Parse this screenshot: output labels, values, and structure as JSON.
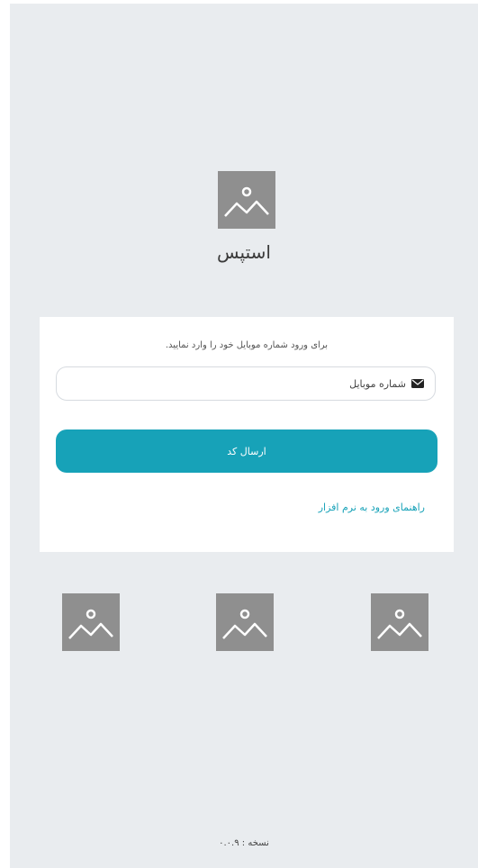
{
  "app": {
    "name": "استپس"
  },
  "login": {
    "prompt": "برای ورود شماره موبایل خود را وارد نمایید.",
    "phone_placeholder": "شماره موبایل",
    "phone_icon": "envelope-icon",
    "send_button": "ارسال کد",
    "help_link": "راهنمای ورود به نرم افزار"
  },
  "footer": {
    "version": "نسخه : ۰.۰.۹"
  },
  "images": {
    "logo_icon": "image-placeholder-icon",
    "bottom_icons": [
      "image-placeholder-icon",
      "image-placeholder-icon",
      "image-placeholder-icon"
    ]
  },
  "colors": {
    "background": "#e9ecef",
    "card": "#ffffff",
    "accent": "#17a2b8",
    "placeholder_image": "#8f8f8f"
  }
}
